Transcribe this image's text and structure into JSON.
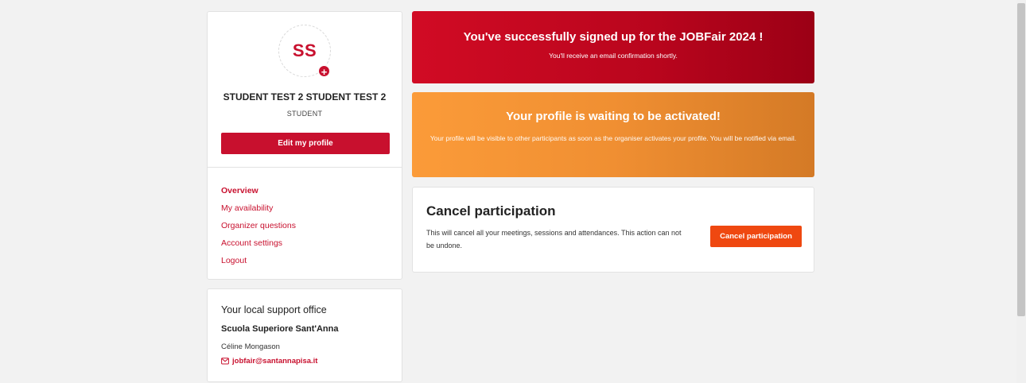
{
  "profile": {
    "initials": "SS",
    "add_photo_glyph": "+",
    "name": "STUDENT TEST 2 STUDENT TEST 2",
    "role": "STUDENT",
    "edit_label": "Edit my profile"
  },
  "nav": {
    "items": [
      {
        "label": "Overview",
        "active": true
      },
      {
        "label": "My availability"
      },
      {
        "label": "Organizer questions"
      },
      {
        "label": "Account settings"
      },
      {
        "label": "Logout"
      }
    ]
  },
  "support": {
    "title": "Your local support office",
    "organization": "Scuola Superiore Sant'Anna",
    "contact_name": "Céline Mongason",
    "email": "jobfair@santannapisa.it",
    "email_icon": "mail-icon"
  },
  "banners": {
    "success": {
      "title": "You've successfully signed up for the JOBFair 2024 !",
      "text": "You'll receive an email confirmation shortly.",
      "color": "#c8102e"
    },
    "warning": {
      "title": "Your profile is waiting to be activated!",
      "text": "Your profile will be visible to other participants as soon as the organiser activates your profile. You will be notified via email.",
      "color": "#f39234"
    }
  },
  "cancel": {
    "title": "Cancel participation",
    "description": "This will cancel all your meetings, sessions and attendances. This action can not be undone.",
    "button_label": "Cancel participation",
    "button_color": "#ef4810"
  },
  "colors": {
    "brand": "#c8102e",
    "background": "#f2f2f2"
  }
}
